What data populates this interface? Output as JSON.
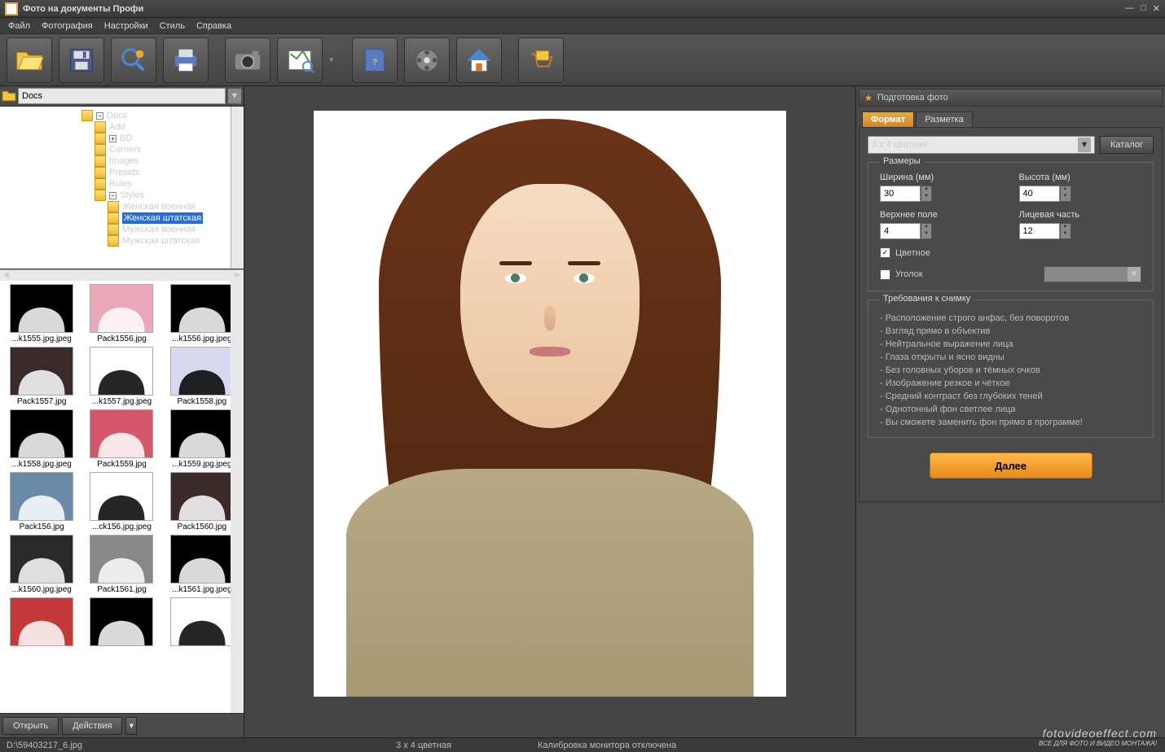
{
  "title": "Фото на документы Профи",
  "menu": [
    "Файл",
    "Фотография",
    "Настройки",
    "Стиль",
    "Справка"
  ],
  "path_value": "Docs",
  "tree": {
    "root": "Docs",
    "children": [
      "Add",
      "BD",
      "Corners",
      "Images",
      "Presets",
      "Rules",
      "Styles"
    ],
    "styles_children": [
      "Женская военная",
      "Женская штатская",
      "Мужская военная",
      "Мужская штатская"
    ],
    "selected": "Женская штатская"
  },
  "thumbs": [
    "...k1555.jpg.jpeg",
    "Pack1556.jpg",
    "...k1556.jpg.jpeg",
    "Pack1557.jpg",
    "...k1557.jpg.jpeg",
    "Pack1558.jpg",
    "...k1558.jpg.jpeg",
    "Pack1559.jpg",
    "...k1559.jpg.jpeg",
    "Pack156.jpg",
    "...ck156.jpg.jpeg",
    "Pack1560.jpg",
    "...k1560.jpg.jpeg",
    "Pack1561.jpg",
    "...k1561.jpg.jpeg",
    "",
    "",
    ""
  ],
  "left_buttons": {
    "open": "Открыть",
    "actions": "Действия"
  },
  "panel_title": "Подготовка фото",
  "tabs": {
    "format": "Формат",
    "markup": "Разметка"
  },
  "format_select": "3 x 4 цветная",
  "catalog_btn": "Каталог",
  "sizes_legend": "Размеры",
  "fields": {
    "width_label": "Ширина (мм)",
    "width_val": "30",
    "height_label": "Высота (мм)",
    "height_val": "40",
    "top_label": "Верхнее поле",
    "top_val": "4",
    "face_label": "Лицевая часть",
    "face_val": "12"
  },
  "checkboxes": {
    "color": "Цветное",
    "corner": "Уголок"
  },
  "req_legend": "Требования к снимку",
  "requirements": [
    "Расположение строго анфас, без поворотов",
    "Взгляд прямо в объектив",
    "Нейтральное выражение лица",
    "Глаза открыты и ясно видны",
    "Без головных уборов и тёмных очков",
    "Изображение резкое и чёткое",
    "Средний контраст без глубоких теней",
    "Однотонный фон светлее лица",
    "Вы сможете заменить фон прямо в программе!"
  ],
  "next_btn": "Далее",
  "status": {
    "file": "D:\\59403217_6.jpg",
    "format": "3 x 4 цветная",
    "calib": "Калибровка монитора отключена"
  },
  "watermark": {
    "big": "fotovideoeffect.com",
    "small": "ВСЕ ДЛЯ ФОТО И ВИДЕО МОНТАЖА!"
  }
}
